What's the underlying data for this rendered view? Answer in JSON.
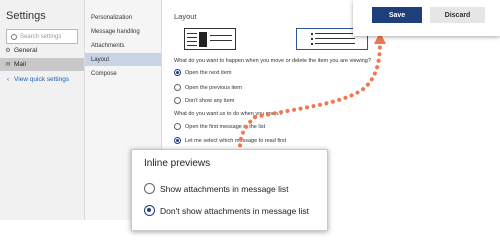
{
  "app": {
    "title": "Settings"
  },
  "search": {
    "placeholder": "Search settings",
    "icon": "search-icon"
  },
  "left_nav": {
    "general": {
      "label": "General",
      "icon": "gear-icon"
    },
    "mail": {
      "label": "Mail",
      "icon": "mail-icon"
    },
    "quick": {
      "label": "View quick settings",
      "icon": "chevron-left-icon"
    }
  },
  "mid_nav": {
    "items": [
      "Personalization",
      "Message handling",
      "Attachments",
      "Layout",
      "Compose"
    ],
    "selected": "Layout"
  },
  "main": {
    "title": "Layout",
    "question1": "What do you want to happen when you move or delete the item you are viewing?",
    "q1_options": [
      "Open the next item",
      "Open the previous item",
      "Don't show any item"
    ],
    "q1_selected": "Open the next item",
    "question2": "What do you want us to do when you open...",
    "q2_options": [
      "Open the first message in the list",
      "Let me select which message to read first"
    ],
    "q2_selected": "Let me select which message to read first"
  },
  "actions": {
    "save_label": "Save",
    "discard_label": "Discard"
  },
  "inline_previews": {
    "title": "Inline previews",
    "options": [
      "Show attachments in message list",
      "Don't show attachments in message list"
    ],
    "selected": "Don't show attachments in message list"
  },
  "colors": {
    "accent": "#1f3f7a",
    "arrow": "#f07850",
    "sidebar_bg": "#f1f1f1",
    "selected_bg": "#c8d3e6"
  }
}
